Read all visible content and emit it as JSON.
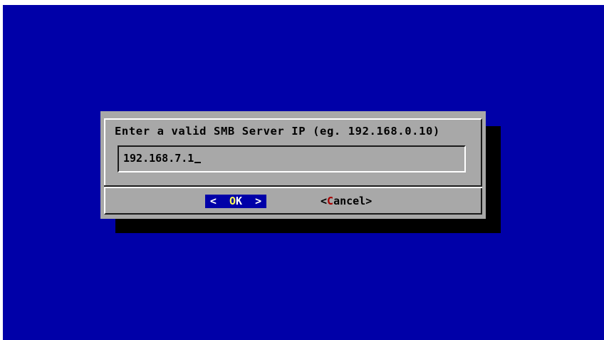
{
  "dialog": {
    "prompt": "Enter a valid SMB Server IP (eg. 192.168.0.10)",
    "input_value": "192.168.7.1"
  },
  "buttons": {
    "ok": {
      "left": "<",
      "hotkey": "O",
      "rest": "K",
      "right": ">"
    },
    "cancel": {
      "open": "<",
      "hotkey": "C",
      "rest": "ancel",
      "close": ">"
    }
  },
  "colors": {
    "background": "#0000a8",
    "dialog": "#a8a8a8",
    "shadow": "#000000",
    "focused_button": "#0000a8",
    "hotkey_inactive": "#a80000"
  }
}
